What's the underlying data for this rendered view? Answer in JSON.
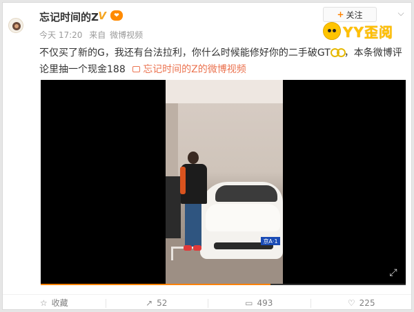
{
  "post": {
    "author": "忘记时间的Z",
    "verified_icon": "verified-v-icon",
    "level_icon": "member-badge-icon",
    "time": "今天 17:20",
    "source_prefix": "来自",
    "source": "微博视频",
    "follow_label": "关注",
    "content_text": "不仅买了新的G，我还有台法拉利，你什么时候能修好你的二手破GT",
    "content_text2": "，本条微博评论里抽一个现金188",
    "video_link_text": "忘记时间的Z的微博视频"
  },
  "watermark": {
    "text": "YY歪阅"
  },
  "video": {
    "plate_text": "京A·1",
    "progress": 0.63
  },
  "actions": [
    {
      "label": "收藏",
      "icon": "star-icon"
    },
    {
      "label": "52",
      "icon": "share-icon"
    },
    {
      "label": "493",
      "icon": "comment-icon"
    },
    {
      "label": "225",
      "icon": "like-icon"
    }
  ],
  "colors": {
    "accent": "#ff8200",
    "link": "#eb7350",
    "watermark": "#ffc000"
  }
}
